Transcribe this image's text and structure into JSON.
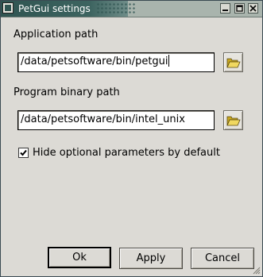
{
  "window": {
    "title": "PetGui settings"
  },
  "application_path": {
    "label": "Application path",
    "value": "/data/petsoftware/bin/petgui"
  },
  "program_binary_path": {
    "label": "Program binary path",
    "value": "/data/petsoftware/bin/intel_unix"
  },
  "options": {
    "hide_optional_label": "Hide optional parameters by default",
    "hide_optional_checked": true
  },
  "buttons": {
    "ok": "Ok",
    "apply": "Apply",
    "cancel": "Cancel"
  },
  "icons": {
    "window_menu": "window-menu-icon",
    "minimize": "minimize-icon",
    "maximize": "maximize-icon",
    "close": "close-icon",
    "browse": "folder-open-icon",
    "check": "checkmark-icon",
    "grip": "resize-grip-icon"
  },
  "colors": {
    "titlebar": "#2f5451",
    "dialog_bg": "#dcdad5",
    "folder_icon": "#e8c840"
  }
}
